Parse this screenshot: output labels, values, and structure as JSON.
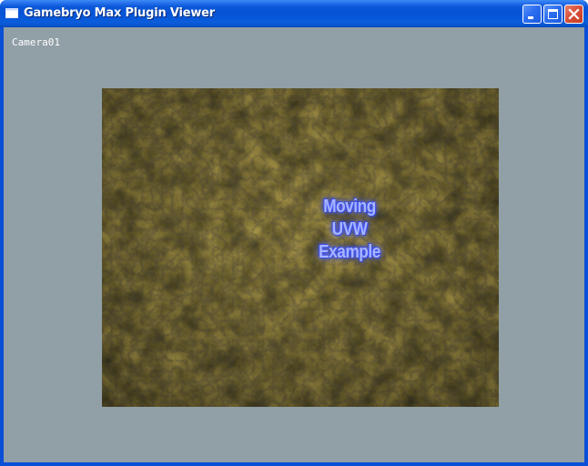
{
  "window": {
    "title": "Gamebryo Max Plugin Viewer",
    "app_icon": "window-icon",
    "controls": {
      "minimize_icon": "minimize-icon",
      "maximize_icon": "maximize-icon",
      "close_icon": "close-icon"
    }
  },
  "viewport": {
    "camera_label": "Camera01",
    "overlay_line1": "Moving UVW",
    "overlay_line2": "Example",
    "background_color": "#919fa6"
  },
  "colors": {
    "titlebar": "#0653d6",
    "client_bg": "#919fa6",
    "overlay_text": "#a8b4ff",
    "close_button": "#d9513a"
  }
}
